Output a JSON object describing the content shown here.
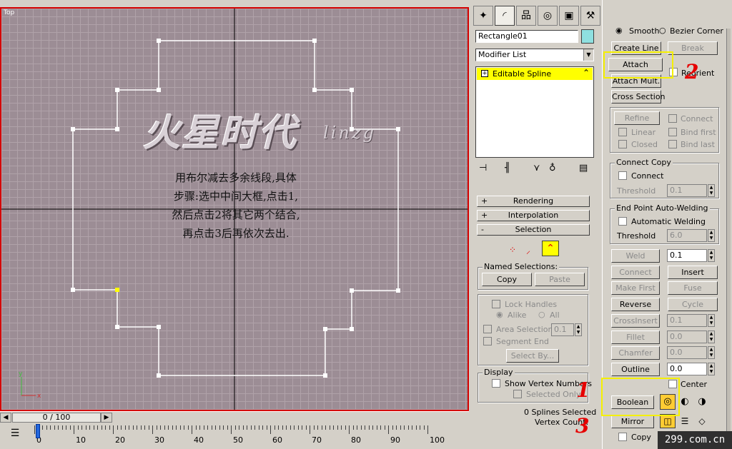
{
  "viewport": {
    "label": "Top",
    "watermark_cn": "火星时代",
    "watermark_latin": "linzg",
    "instructions": [
      "用布尔减去多余线段,具体",
      "步骤:选中中间大框,点击1,",
      "然后点击2将其它两个结合,",
      "再点击3后再依次去出."
    ],
    "axis_y": "y",
    "axis_x": "x"
  },
  "timebar": {
    "position": "0 / 100",
    "prev_icon": "◀",
    "next_icon": "▶"
  },
  "trackbar": {
    "ticks": [
      "0",
      "10",
      "20",
      "30",
      "40",
      "50",
      "60",
      "70",
      "80",
      "90",
      "100"
    ]
  },
  "panel": {
    "tabs": [
      "create-tab",
      "modify-tab",
      "hierarchy-tab",
      "motion-tab",
      "display-tab",
      "utilities-tab"
    ],
    "object_name": "Rectangle01",
    "object_color": "#8fe0e0",
    "modifier_list": "Modifier List",
    "stack_item": "Editable Spline",
    "rollouts": {
      "rendering": "Rendering",
      "interpolation": "Interpolation",
      "selection": "Selection"
    },
    "named_selections": {
      "title": "Named Selections:",
      "copy": "Copy",
      "paste": "Paste"
    },
    "lock_handles": "Lock Handles",
    "alike": "Alike",
    "all": "All",
    "area_selection": "Area Selection:",
    "area_value": "0.1",
    "segment_end": "Segment End",
    "select_by": "Select By...",
    "display": {
      "title": "Display",
      "show_vertex_numbers": "Show Vertex Numbers",
      "selected_only": "Selected Only"
    },
    "splines_selected": "0 Splines Selected",
    "vertex_count": "Vertex Count:",
    "geometry": {
      "smooth": "Smooth",
      "bezier_corner": "Bezier Corner",
      "create_line": "Create Line",
      "break": "Break",
      "attach": "Attach",
      "reorient": "Reorient",
      "attach_mult": "Attach Mult.",
      "cross_section": "Cross Section",
      "refine": "Refine",
      "connect": "Connect",
      "linear": "Linear",
      "bind_first": "Bind first",
      "closed": "Closed",
      "bind_last": "Bind last",
      "connect_copy_title": "Connect Copy",
      "connect_copy": "Connect",
      "threshold_label": "Threshold",
      "cc_threshold": "0.1",
      "end_point_title": "End Point Auto-Welding",
      "automatic_welding": "Automatic Welding",
      "ep_threshold": "6.0",
      "weld": "Weld",
      "weld_value": "0.1",
      "connect_btn": "Connect",
      "insert": "Insert",
      "make_first": "Make First",
      "fuse": "Fuse",
      "reverse": "Reverse",
      "cycle": "Cycle",
      "crossinsert": "CrossInsert",
      "crossinsert_value": "0.1",
      "fillet": "Fillet",
      "fillet_value": "0.0",
      "chamfer": "Chamfer",
      "chamfer_value": "0.0",
      "outline": "Outline",
      "outline_value": "0.0",
      "center": "Center",
      "boolean": "Boolean",
      "mirror": "Mirror",
      "copy": "Copy"
    }
  },
  "annotations": {
    "one": "1",
    "two": "2",
    "three": "3"
  },
  "brand": "299.com.cn"
}
